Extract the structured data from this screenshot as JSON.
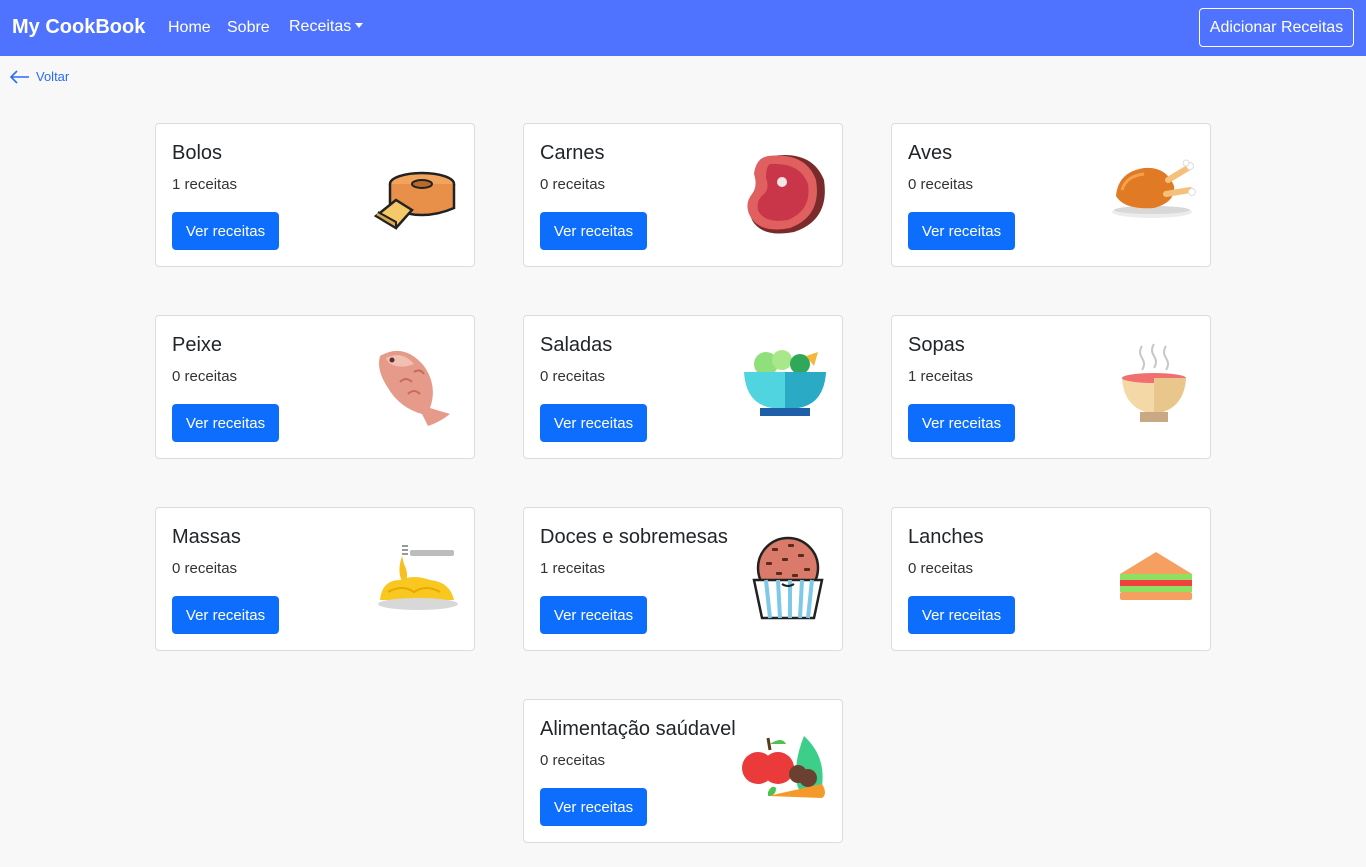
{
  "navbar": {
    "brand": "My CookBook",
    "links": [
      "Home",
      "Sobre"
    ],
    "dropdown_label": "Receitas",
    "add_button": "Adicionar Receitas"
  },
  "back_link": "Voltar",
  "categories": [
    {
      "title": "Bolos",
      "count": "1 receitas",
      "button": "Ver receitas",
      "icon": "cake-icon"
    },
    {
      "title": "Carnes",
      "count": "0 receitas",
      "button": "Ver receitas",
      "icon": "steak-icon"
    },
    {
      "title": "Aves",
      "count": "0 receitas",
      "button": "Ver receitas",
      "icon": "roast-chicken-icon"
    },
    {
      "title": "Peixe",
      "count": "0 receitas",
      "button": "Ver receitas",
      "icon": "fish-icon"
    },
    {
      "title": "Saladas",
      "count": "0 receitas",
      "button": "Ver receitas",
      "icon": "salad-bowl-icon"
    },
    {
      "title": "Sopas",
      "count": "1 receitas",
      "button": "Ver receitas",
      "icon": "soup-bowl-icon"
    },
    {
      "title": "Massas",
      "count": "0 receitas",
      "button": "Ver receitas",
      "icon": "pasta-icon"
    },
    {
      "title": "Doces e sobremesas",
      "count": "1 receitas",
      "button": "Ver receitas",
      "icon": "cupcake-icon"
    },
    {
      "title": "Lanches",
      "count": "0 receitas",
      "button": "Ver receitas",
      "icon": "sandwich-icon"
    },
    {
      "title": "Alimentação saúdavel",
      "count": "0 receitas",
      "button": "Ver receitas",
      "icon": "healthy-food-icon"
    }
  ]
}
